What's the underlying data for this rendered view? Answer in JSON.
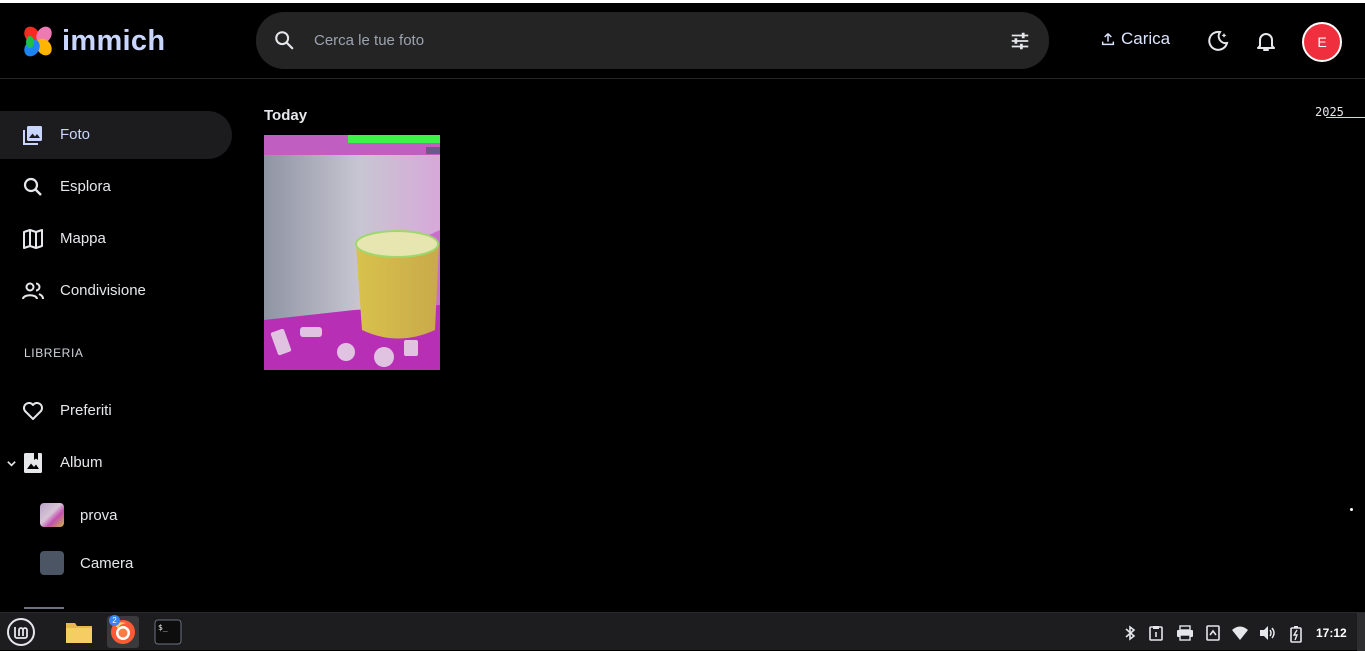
{
  "app": {
    "logo_text": "immich",
    "search_placeholder": "Cerca le tue foto",
    "upload_label": "Carica",
    "avatar_initial": "E"
  },
  "sidebar": {
    "items": [
      {
        "label": "Foto",
        "icon": "photos-icon",
        "active": true
      },
      {
        "label": "Esplora",
        "icon": "search-icon",
        "active": false
      },
      {
        "label": "Mappa",
        "icon": "map-icon",
        "active": false
      },
      {
        "label": "Condivisione",
        "icon": "sharing-icon",
        "active": false
      }
    ],
    "library_label": "LIBRERIA",
    "library_items": [
      {
        "label": "Preferiti",
        "icon": "heart-icon"
      },
      {
        "label": "Album",
        "icon": "album-icon"
      }
    ],
    "albums": [
      {
        "label": "prova",
        "icon": "album-thumbnail"
      },
      {
        "label": "Camera",
        "icon": "album-thumbnail"
      }
    ]
  },
  "timeline": {
    "group_title": "Today",
    "year_marker": "2025"
  },
  "taskbar": {
    "badge_count": "2",
    "clock": "17:12"
  },
  "colors": {
    "accent": "#c9d6ff",
    "avatar_bg": "#ef2f3d",
    "search_bg": "#242424",
    "taskbar_bg": "#1d1d1f"
  }
}
